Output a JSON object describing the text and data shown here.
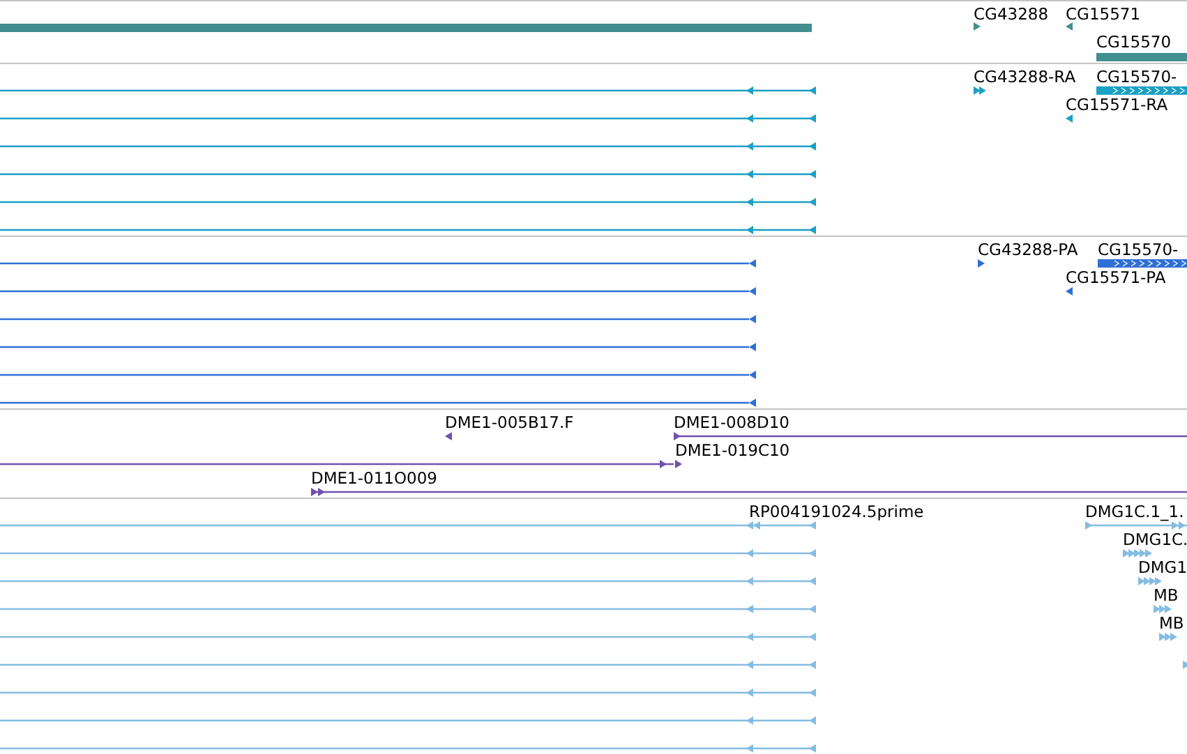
{
  "tracks": [
    {
      "color": "#428f92",
      "labels": [
        "CG43288",
        "CG15571",
        "CG15570"
      ]
    },
    {
      "color": "#1aa0c4",
      "labels": [
        "CG43288-RA",
        "CG15570-",
        "CG15571-RA"
      ]
    },
    {
      "color": "#2f6fd6",
      "labels": [
        "CG43288-PA",
        "CG15570-",
        "CG15571-PA"
      ]
    },
    {
      "color": "#7050b0",
      "labels": [
        "DME1-005B17.F",
        "DME1-008D10",
        "DME1-019C10",
        "DME1-011O009"
      ]
    },
    {
      "color": "#84bce2",
      "labels": [
        "RP004191024.5prime",
        "DMG1C.1_1.",
        "DMG1C.",
        "DMG1",
        "MB",
        "MB"
      ]
    }
  ]
}
